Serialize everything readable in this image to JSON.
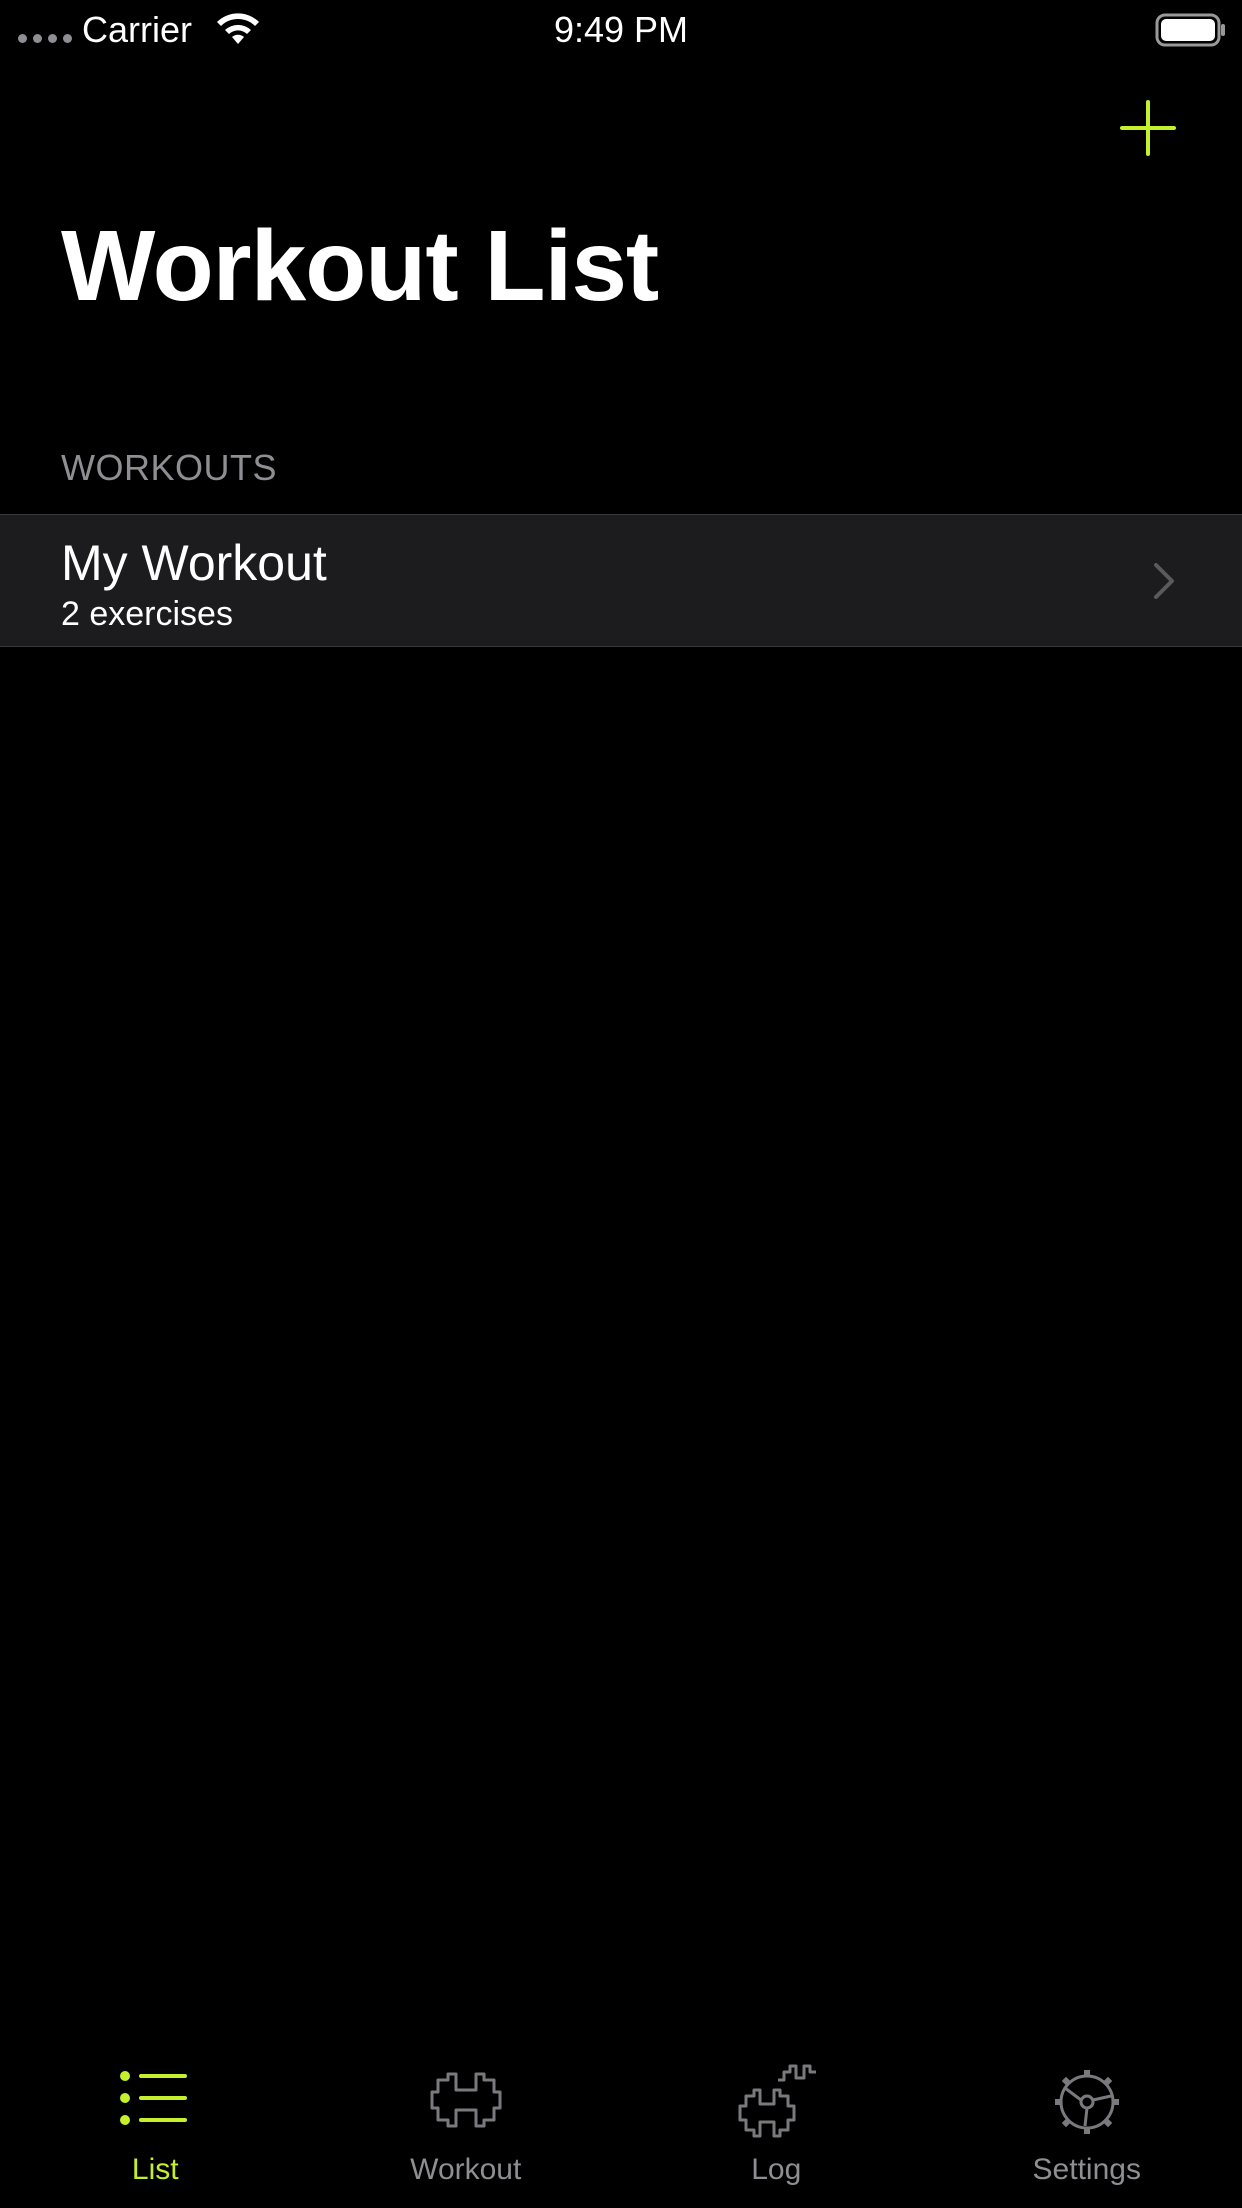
{
  "status_bar": {
    "carrier": "Carrier",
    "time": "9:49 PM",
    "icons": [
      "signal-dots-icon",
      "wifi-icon",
      "battery-icon"
    ]
  },
  "nav": {
    "title": "Workout List",
    "add_icon": "plus-icon"
  },
  "section": {
    "header": "WORKOUTS"
  },
  "workouts": [
    {
      "title": "My Workout",
      "subtitle": "2 exercises",
      "icon": "chevron-right-icon"
    }
  ],
  "tabs": [
    {
      "label": "List",
      "icon": "list-icon",
      "active": true
    },
    {
      "label": "Workout",
      "icon": "dumbbell-icon",
      "active": false
    },
    {
      "label": "Log",
      "icon": "log-dumbbells-icon",
      "active": false
    },
    {
      "label": "Settings",
      "icon": "gear-icon",
      "active": false
    }
  ],
  "colors": {
    "accent": "#c5f02c",
    "background": "#000000",
    "row_background": "#1c1c1e",
    "secondary_text": "#8e8e93"
  }
}
